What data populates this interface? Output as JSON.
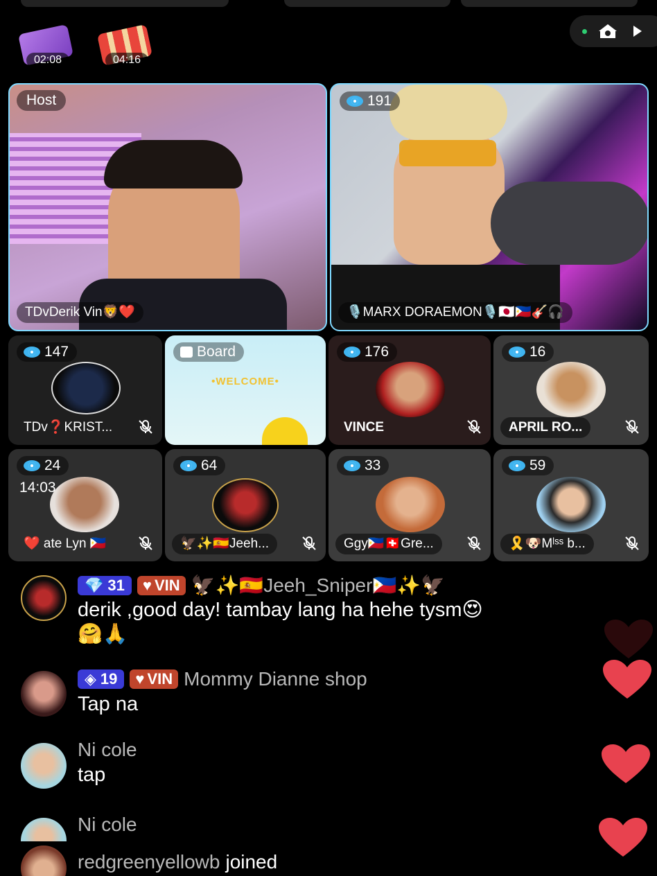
{
  "gifts": [
    {
      "timer": "02:08",
      "color": "#9b59d6"
    },
    {
      "timer": "04:16",
      "color": "#e05b4c"
    }
  ],
  "host_tile": {
    "tag": "Host",
    "name": "TDvDerik Vin🦁❤️"
  },
  "cohost_tile": {
    "viewers": "191",
    "name": "🎙️MARX DORAEMON🎙️🇯🇵🇵🇭🎸🎧"
  },
  "small_tiles": [
    {
      "viewers": "147",
      "name": "TDv❓KRIST..."
    },
    {
      "board_label": "Board",
      "welcome": "•WELCOME•"
    },
    {
      "viewers": "176",
      "name": "VINCE"
    },
    {
      "viewers": "16",
      "name": "APRIL RO..."
    },
    {
      "viewers": "24",
      "time": "14:03",
      "name": "❤️ ate Lyn 🇵🇭"
    },
    {
      "viewers": "64",
      "name": "🦅✨🇪🇸Jeeh..."
    },
    {
      "viewers": "33",
      "name": "Ggy🇵🇭🇨🇭Gre..."
    },
    {
      "viewers": "59",
      "name": "🎗️🐶Mˡˢˢ b..."
    }
  ],
  "chat": [
    {
      "level": "31",
      "vin": "VIN",
      "user": "🦅✨🇪🇸Jeeh_Sniper🇵🇭✨🦅",
      "message": "derik ,good day! tambay lang ha hehe tysm😍",
      "message2": "🤗🙏"
    },
    {
      "level": "19",
      "vin": "VIN",
      "user": "Mommy Dianne shop",
      "message": "Tap na"
    },
    {
      "user": "Ni cole",
      "message": "tap"
    },
    {
      "user": "Ni cole"
    },
    {
      "user": "redgreenyellowb",
      "action": "joined"
    }
  ],
  "colors": {
    "accent": "#3fb4f0",
    "heart": "#e8424f",
    "vin": "#c0452c",
    "level": "#3a3ad6"
  }
}
